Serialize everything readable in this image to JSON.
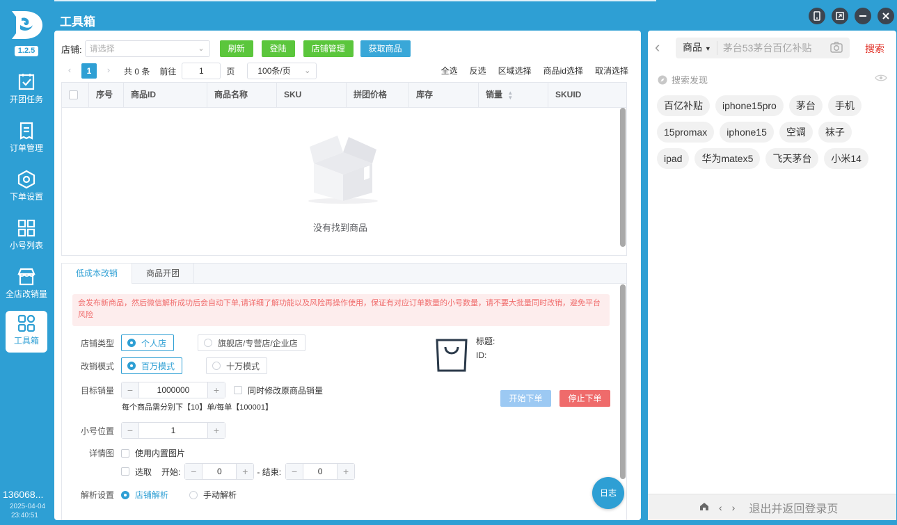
{
  "app": {
    "title": "工具箱",
    "version": "1.2.5"
  },
  "sidebar": {
    "items": [
      {
        "label": "开团任务",
        "icon": "checklist-icon"
      },
      {
        "label": "订单管理",
        "icon": "document-list-icon"
      },
      {
        "label": "下单设置",
        "icon": "hexagon-settings-icon"
      },
      {
        "label": "小号列表",
        "icon": "grid-icon"
      },
      {
        "label": "全店改销量",
        "icon": "store-icon"
      },
      {
        "label": "工具箱",
        "icon": "toolbox-grid-icon",
        "active": true
      }
    ],
    "account": "136068...",
    "date": "2025-04-04",
    "time": "23:40:51"
  },
  "toolbar": {
    "shop_label": "店铺:",
    "shop_placeholder": "请选择",
    "refresh": "刷新",
    "login": "登陆",
    "shop_manage": "店铺管理",
    "fetch_goods": "获取商品"
  },
  "pager": {
    "current": "1",
    "total": "共 0 条",
    "goto_label": "前往",
    "goto_value": "1",
    "page_unit": "页",
    "page_size": "100条/页",
    "select_all": "全选",
    "invert": "反选",
    "range_select": "区域选择",
    "id_select": "商品id选择",
    "cancel_select": "取消选择"
  },
  "table": {
    "columns": [
      "序号",
      "商品ID",
      "商品名称",
      "SKU",
      "拼团价格",
      "库存",
      "销量",
      "SKUID"
    ],
    "empty_text": "没有找到商品"
  },
  "tabs": [
    "低成本改销",
    "商品开团"
  ],
  "warning": "会发布新商品，然后微信解析成功后会自动下单,请详细了解功能以及风险再操作使用，保证有对应订单数量的小号数量，请不要大批量同时改销，避免平台风险",
  "form": {
    "shop_type_label": "店铺类型",
    "shop_type_personal": "个人店",
    "shop_type_flagship": "旗舰店/专营店/企业店",
    "mode_label": "改销模式",
    "mode_million": "百万模式",
    "mode_100k": "十万模式",
    "target_label": "目标销量",
    "target_value": "1000000",
    "sync_label": "同时修改原商品销量",
    "hint": "每个商品需分别下【10】单/每单【100001】",
    "position_label": "小号位置",
    "position_value": "1",
    "detail_label": "详情图",
    "builtin_img": "使用内置图片",
    "pick_label": "选取",
    "start_label": "开始:",
    "start_value": "0",
    "end_label": "- 结束:",
    "end_value": "0",
    "parse_label": "解析设置",
    "parse_shop": "店铺解析",
    "parse_manual": "手动解析",
    "title_label": "标题:",
    "id_label": "ID:",
    "start_order": "开始下单",
    "stop_order": "停止下单",
    "log": "日志"
  },
  "right": {
    "category": "商品",
    "placeholder": "茅台53茅台百亿补贴",
    "search": "搜索",
    "discover": "搜索发现",
    "chips": [
      "百亿补贴",
      "iphone15pro",
      "茅台",
      "手机",
      "15promax",
      "iphone15",
      "空调",
      "袜子",
      "ipad",
      "华为matex5",
      "飞天茅台",
      "小米14"
    ],
    "exit": "退出并返回登录页"
  },
  "colors": {
    "primary": "#2e9fd4",
    "green": "#5bc63c",
    "danger": "#ef6b6b",
    "search_red": "#e02e24"
  }
}
